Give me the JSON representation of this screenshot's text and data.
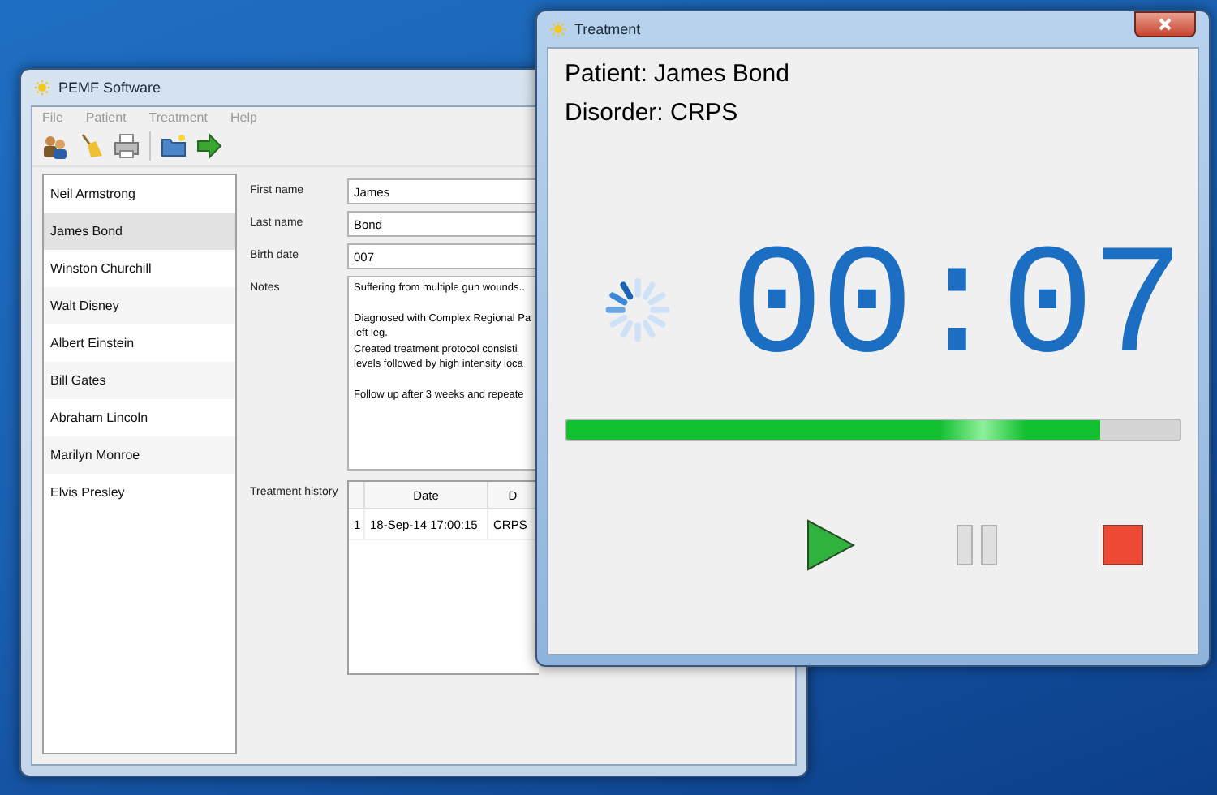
{
  "main_window": {
    "title": "PEMF Software",
    "active": false
  },
  "menu": [
    "File",
    "Patient",
    "Treatment",
    "Help"
  ],
  "patients": [
    {
      "name": "Neil Armstrong",
      "selected": false
    },
    {
      "name": "James Bond",
      "selected": true
    },
    {
      "name": "Winston Churchill",
      "selected": false
    },
    {
      "name": "Walt Disney",
      "selected": false
    },
    {
      "name": "Albert Einstein",
      "selected": false
    },
    {
      "name": "Bill Gates",
      "selected": false
    },
    {
      "name": "Abraham Lincoln",
      "selected": false
    },
    {
      "name": "Marilyn  Monroe",
      "selected": false
    },
    {
      "name": "Elvis  Presley",
      "selected": false
    }
  ],
  "form": {
    "fields": [
      {
        "label": "First name",
        "value": "James"
      },
      {
        "label": "Last name",
        "value": "Bond"
      },
      {
        "label": "Birth date",
        "value": "007"
      }
    ],
    "notes": {
      "label": "Notes",
      "paragraphs": [
        [
          "Suffering from multiple gun wounds.."
        ],
        [
          "Diagnosed with Complex Regional Pa",
          "left leg.",
          "Created treatment protocol consisti",
          "levels followed by high intensity loca"
        ],
        [
          "Follow up after 3 weeks and repeate"
        ]
      ]
    },
    "history": {
      "label": "Treatment history",
      "columns": [
        "Date",
        "D"
      ],
      "rows": [
        {
          "number": "1",
          "cells": [
            "18-Sep-14 17:00:15",
            "CRPS"
          ]
        }
      ]
    }
  },
  "treatment_window": {
    "title": "Treatment",
    "active": true,
    "patient": "Patient: James Bond",
    "disorder": "Disorder: CRPS",
    "timer": "00:07",
    "progress": {
      "level": 0.87
    },
    "buttons": [
      {
        "kind": "play",
        "disabled": false
      },
      {
        "kind": "pause",
        "disabled": true
      },
      {
        "kind": "stop",
        "disabled": false
      }
    ]
  }
}
